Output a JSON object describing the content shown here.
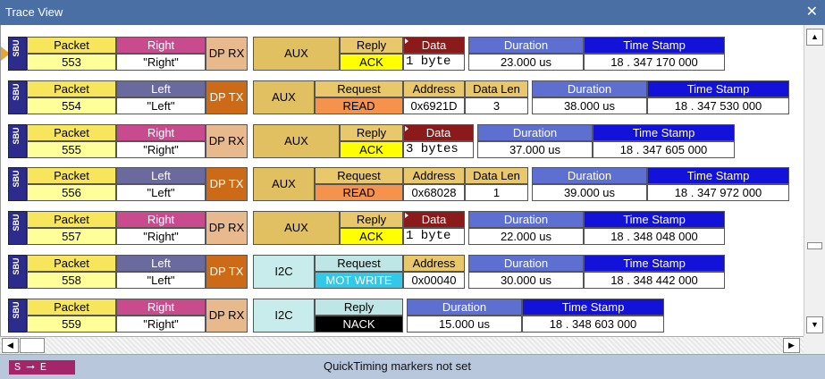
{
  "window": {
    "title": "Trace View",
    "close_glyph": "✕"
  },
  "status": {
    "se_label": "S ⟶ E",
    "message": "QuickTiming markers not set"
  },
  "colors": {
    "titlebar": "#4a6fa5",
    "status_bar": "#b9c7dc",
    "sbu": "#2c2c8c"
  },
  "rows": [
    {
      "sbu": "SBU",
      "packet_label": "Packet",
      "packet": "553",
      "dir_label": "Right",
      "dir_value": "\"Right\"",
      "port": "DP RX",
      "channel": "AUX",
      "type_label": "Reply",
      "type_value": "ACK",
      "data_label": "Data",
      "data_value": "1 byte",
      "duration_label": "Duration",
      "duration": "23.000 us",
      "ts_label": "Time Stamp",
      "ts": "18 . 347 170 000"
    },
    {
      "sbu": "SBU",
      "packet_label": "Packet",
      "packet": "554",
      "dir_label": "Left",
      "dir_value": "\"Left\"",
      "port": "DP TX",
      "channel": "AUX",
      "type_label": "Request",
      "type_value": "READ",
      "addr_label": "Address",
      "addr": "0x6921D",
      "dlen_label": "Data Len",
      "dlen": "3",
      "duration_label": "Duration",
      "duration": "38.000 us",
      "ts_label": "Time Stamp",
      "ts": "18 . 347 530 000"
    },
    {
      "sbu": "SBU",
      "packet_label": "Packet",
      "packet": "555",
      "dir_label": "Right",
      "dir_value": "\"Right\"",
      "port": "DP RX",
      "channel": "AUX",
      "type_label": "Reply",
      "type_value": "ACK",
      "data_label": "Data",
      "data_value": "3 bytes",
      "duration_label": "Duration",
      "duration": "37.000 us",
      "ts_label": "Time Stamp",
      "ts": "18 . 347 605 000"
    },
    {
      "sbu": "SBU",
      "packet_label": "Packet",
      "packet": "556",
      "dir_label": "Left",
      "dir_value": "\"Left\"",
      "port": "DP TX",
      "channel": "AUX",
      "type_label": "Request",
      "type_value": "READ",
      "addr_label": "Address",
      "addr": "0x68028",
      "dlen_label": "Data Len",
      "dlen": "1",
      "duration_label": "Duration",
      "duration": "39.000 us",
      "ts_label": "Time Stamp",
      "ts": "18 . 347 972 000"
    },
    {
      "sbu": "SBU",
      "packet_label": "Packet",
      "packet": "557",
      "dir_label": "Right",
      "dir_value": "\"Right\"",
      "port": "DP RX",
      "channel": "AUX",
      "type_label": "Reply",
      "type_value": "ACK",
      "data_label": "Data",
      "data_value": "1 byte",
      "duration_label": "Duration",
      "duration": "22.000 us",
      "ts_label": "Time Stamp",
      "ts": "18 . 348 048 000"
    },
    {
      "sbu": "SBU",
      "packet_label": "Packet",
      "packet": "558",
      "dir_label": "Left",
      "dir_value": "\"Left\"",
      "port": "DP TX",
      "channel": "I2C",
      "type_label": "Request",
      "type_value": "MOT WRITE",
      "addr_label": "Address",
      "addr": "0x00040",
      "duration_label": "Duration",
      "duration": "30.000 us",
      "ts_label": "Time Stamp",
      "ts": "18 . 348 442 000"
    },
    {
      "sbu": "SBU",
      "packet_label": "Packet",
      "packet": "559",
      "dir_label": "Right",
      "dir_value": "\"Right\"",
      "port": "DP RX",
      "channel": "I2C",
      "type_label": "Reply",
      "type_value": "NACK",
      "duration_label": "Duration",
      "duration": "15.000 us",
      "ts_label": "Time Stamp",
      "ts": "18 . 348 603 000"
    }
  ]
}
